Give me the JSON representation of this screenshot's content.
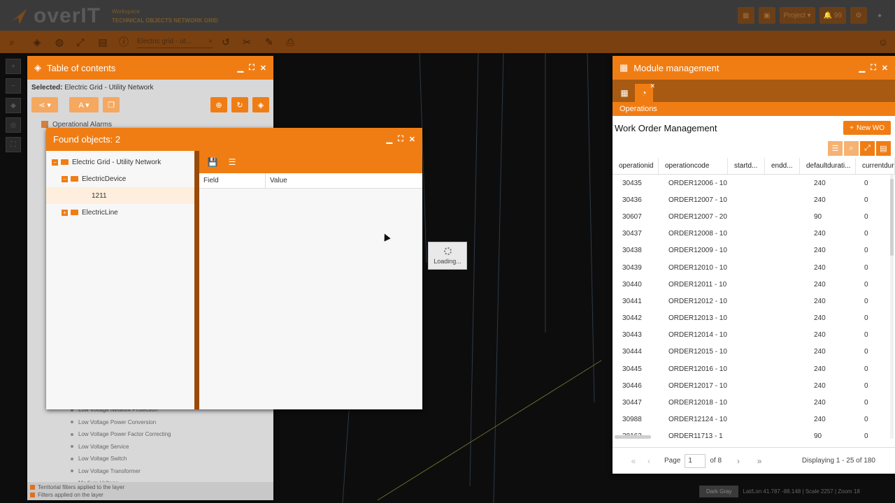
{
  "app": {
    "logo_text": "overIT",
    "subtitle_1": "Workspace",
    "subtitle_2": "TECHNICAL OBJECTS NETWORK GRID",
    "top_right": {
      "project_label": "Project",
      "notif_count": "99"
    }
  },
  "toolbar": {
    "search_value": "Electric grid - ut...",
    "search_clear": "×"
  },
  "toc": {
    "title": "Table of contents",
    "selected_label": "Selected:",
    "selected_value": "Electric Grid - Utility Network",
    "rows": [
      {
        "label": "Operational Alarms"
      }
    ],
    "sub_items": [
      "Low Voltage Network Protection",
      "Low Voltage Power Conversion",
      "Low Voltage Power Factor Correcting",
      "Low Voltage Service",
      "Low Voltage Switch",
      "Low Voltage Transformer",
      "Medium Voltage ..."
    ],
    "footer": {
      "territorial": "Territorial filters applied to the layer",
      "filters": "Filters applied on the layer"
    }
  },
  "found": {
    "title": "Found objects: 2",
    "tree": [
      {
        "label": "Electric Grid - Utility Network",
        "toggle": "−",
        "level": 0
      },
      {
        "label": "ElectricDevice",
        "toggle": "−",
        "level": 1
      },
      {
        "label": "1211",
        "toggle": "",
        "level": 2
      },
      {
        "label": "ElectricLine",
        "toggle": "+",
        "level": 1
      }
    ],
    "columns": {
      "field": "Field",
      "value": "Value"
    }
  },
  "loading": {
    "text": "Loading..."
  },
  "module": {
    "title": "Module management",
    "section": "Operations",
    "wo_title": "Work Order Management",
    "new_wo": "New WO",
    "columns": [
      "operationid",
      "operationcode",
      "startd...",
      "endd...",
      "defaultdurati...",
      "currentdur"
    ],
    "rows": [
      [
        "30435",
        "ORDER12006 - 10",
        "",
        "",
        "240",
        "0"
      ],
      [
        "30436",
        "ORDER12007 - 10",
        "",
        "",
        "240",
        "0"
      ],
      [
        "30607",
        "ORDER12007 - 20",
        "",
        "",
        "90",
        "0"
      ],
      [
        "30437",
        "ORDER12008 - 10",
        "",
        "",
        "240",
        "0"
      ],
      [
        "30438",
        "ORDER12009 - 10",
        "",
        "",
        "240",
        "0"
      ],
      [
        "30439",
        "ORDER12010 - 10",
        "",
        "",
        "240",
        "0"
      ],
      [
        "30440",
        "ORDER12011 - 10",
        "",
        "",
        "240",
        "0"
      ],
      [
        "30441",
        "ORDER12012 - 10",
        "",
        "",
        "240",
        "0"
      ],
      [
        "30442",
        "ORDER12013 - 10",
        "",
        "",
        "240",
        "0"
      ],
      [
        "30443",
        "ORDER12014 - 10",
        "",
        "",
        "240",
        "0"
      ],
      [
        "30444",
        "ORDER12015 - 10",
        "",
        "",
        "240",
        "0"
      ],
      [
        "30445",
        "ORDER12016 - 10",
        "",
        "",
        "240",
        "0"
      ],
      [
        "30446",
        "ORDER12017 - 10",
        "",
        "",
        "240",
        "0"
      ],
      [
        "30447",
        "ORDER12018 - 10",
        "",
        "",
        "240",
        "0"
      ],
      [
        "30988",
        "ORDER12124 - 10",
        "",
        "",
        "240",
        "0"
      ],
      [
        "28162",
        "ORDER11713 - 1",
        "",
        "",
        "90",
        "0"
      ]
    ],
    "pager": {
      "page_label": "Page",
      "page_value": "1",
      "of_label": "of 8",
      "displaying": "Displaying 1 - 25 of 180"
    }
  },
  "status": {
    "basemap": "Dark Gray",
    "coords": "Lat/Lon 41.787 -88.148 | Scale 2257 | Zoom 18"
  }
}
